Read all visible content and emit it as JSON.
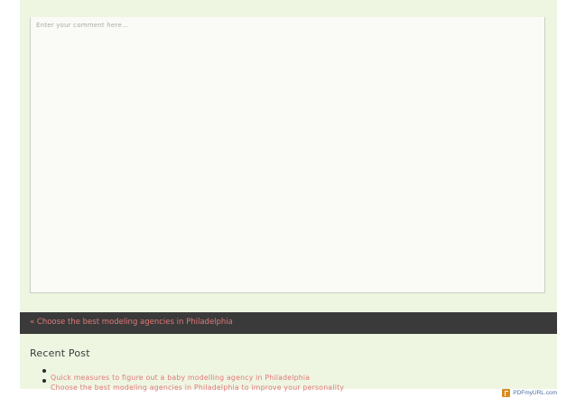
{
  "comment": {
    "placeholder": "Enter your comment here..."
  },
  "post_nav": {
    "previous_label": "« Choose the best modeling agencies in Philadelphia"
  },
  "recent_posts": {
    "title": "Recent Post",
    "items": [
      {
        "label": "Quick measures to figure out a baby modelling agency in Philadelphia"
      },
      {
        "label": "Choose the best modeling agencies in Philadelphia to improve your personality"
      }
    ]
  },
  "footer": {
    "badge_icon": "pdf-icon",
    "badge_text": "PDFmyURL.com"
  },
  "colors": {
    "background": "#eef6e2",
    "nav_bar": "#3a3a3a",
    "link": "#e07979"
  }
}
